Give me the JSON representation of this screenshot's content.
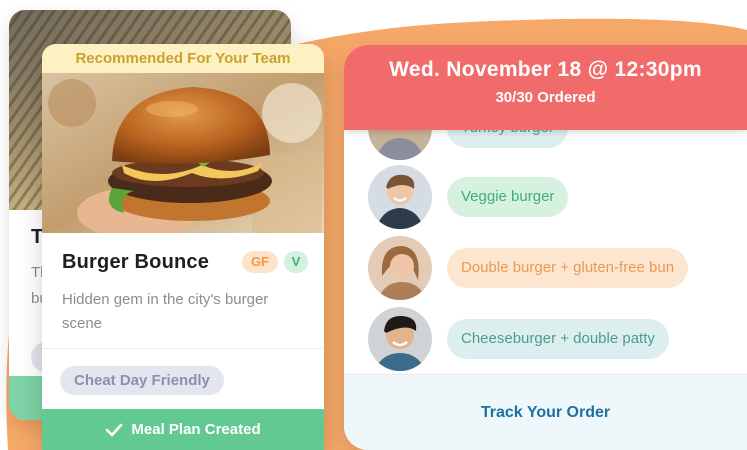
{
  "back_card": {
    "title": "T",
    "description": "Th bu"
  },
  "meal_card": {
    "banner": "Recommended For Your Team",
    "title": "Burger Bounce",
    "badges": [
      "GF",
      "V"
    ],
    "description": "Hidden gem in the city's burger scene",
    "tag": "Cheat Day Friendly",
    "button_label": "Meal Plan Created",
    "button_icon": "checkmark-icon"
  },
  "order_panel": {
    "date_time": "Wed. November 18 @ 12:30pm",
    "ordered_count": "30/30 Ordered",
    "orders": [
      {
        "item": "Turkey burger",
        "pill_color": "#dcefee"
      },
      {
        "item": "Veggie burger",
        "pill_color": "#d6f1e0"
      },
      {
        "item": "Double burger + gluten-free bun",
        "pill_color": "#fde6cf"
      },
      {
        "item": "Cheeseburger + double patty",
        "pill_color": "#dcefee"
      }
    ],
    "track_label": "Track Your Order"
  },
  "colors": {
    "header_red": "#f26b6b",
    "success_green": "#63c993",
    "blob_orange": "#f6a868",
    "track_blue": "#1f6fa0"
  }
}
